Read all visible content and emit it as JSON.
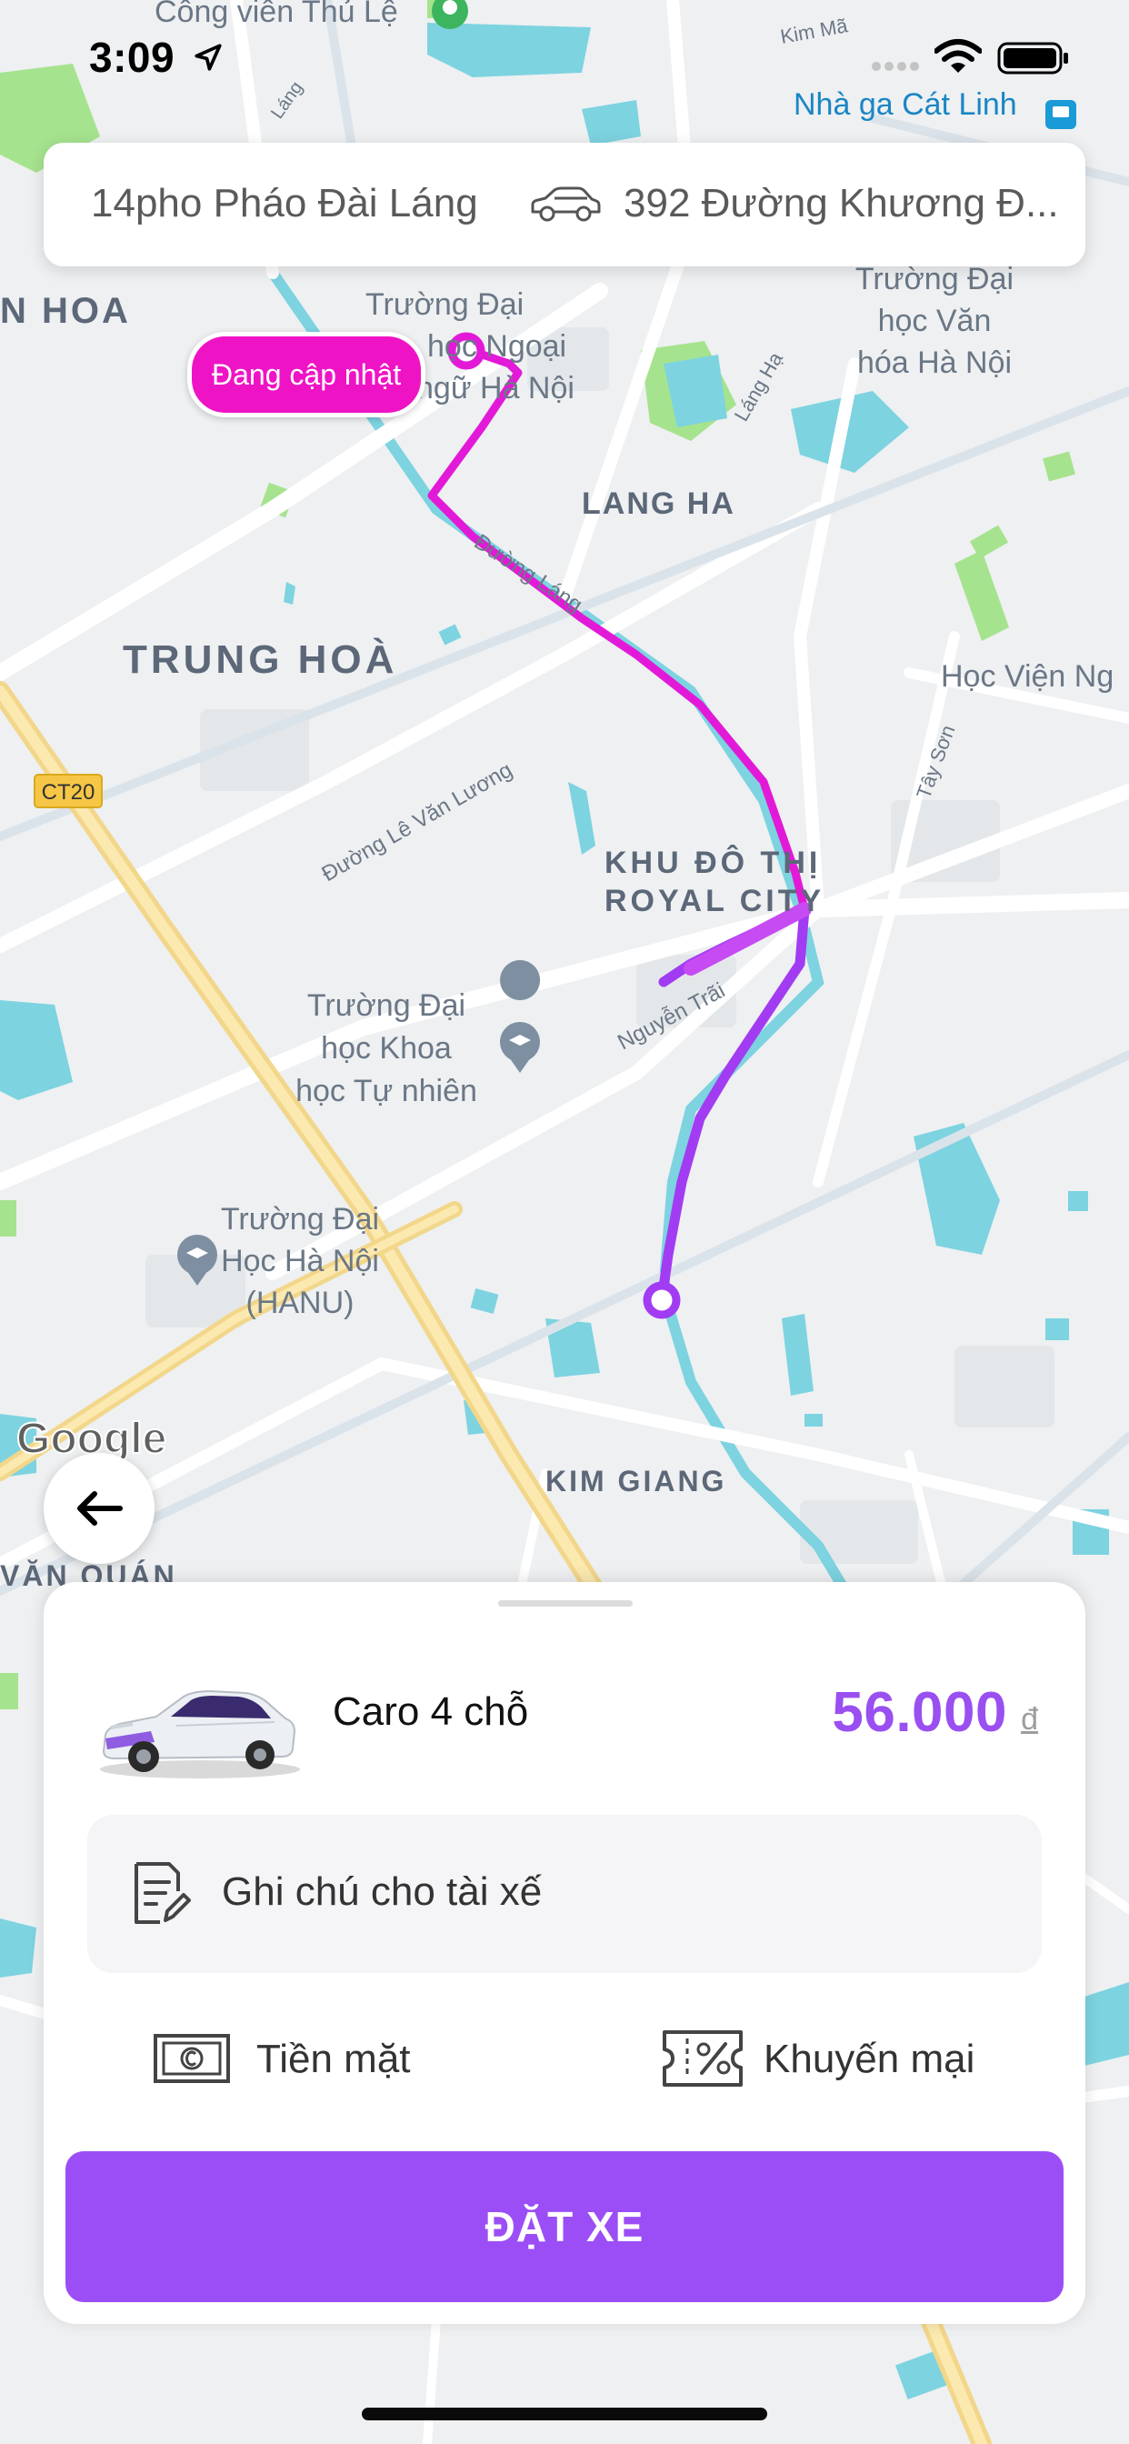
{
  "status_bar": {
    "time": "3:09"
  },
  "map": {
    "labels": {
      "cong_vien": "Công viên Thủ Lệ",
      "ga_cat_linh": "Nhà ga Cát Linh",
      "kim_ma": "Kim Mã",
      "hoa": "N HOA",
      "truong_ngoai_ngu_1": "Trường Đại",
      "truong_ngoai_ngu_2": "học Ngoại",
      "truong_ngoai_ngu_3": "ngữ Hà Nội",
      "van_hoa_1": "Trường Đại",
      "van_hoa_2": "học Văn",
      "van_hoa_3": "hóa Hà Nội",
      "lang_ha": "LANG HA",
      "lang_ha_road": "Láng Hạ",
      "duong_lang": "Đường Láng",
      "trung_hoa": "TRUNG HOÀ",
      "hoc_vien": "Học Viện Ng",
      "ct20": "CT20",
      "le_van_luong": "Đường Lê Văn Lương",
      "tay_son": "Tây Sơn",
      "royal_1": "KHU ĐÔ THỊ",
      "royal_2": "ROYAL CITY",
      "khtn_1": "Trường Đại",
      "khtn_2": "học Khoa",
      "khtn_3": "học Tự nhiên",
      "nguyen_trai": "Nguyễn Trãi",
      "hanu_1": "Trường Đại",
      "hanu_2": "Học Hà Nội",
      "hanu_3": "(HANU)",
      "google": "Google",
      "kim_giang": "KIM GIANG",
      "van_quan": "VĂN QUÁN",
      "lang_small": "Láng"
    },
    "update_badge": "Đang cập nhật",
    "colors": {
      "route_magenta": "#e21ad8",
      "route_purple": "#a23cf2",
      "water": "#7dd3e0",
      "park": "#a6e38e"
    }
  },
  "route": {
    "pickup": "14pho Pháo Đài Láng",
    "destination": "392 Đường Khương Đ..."
  },
  "booking": {
    "vehicle_name": "Caro 4 chỗ",
    "price": "56.000",
    "currency": "đ",
    "note_placeholder": "Ghi chú cho tài xế",
    "payment": "Tiền mặt",
    "promotion": "Khuyến mại",
    "book_button": "ĐẶT XE",
    "accent": "#9b4ef5"
  }
}
